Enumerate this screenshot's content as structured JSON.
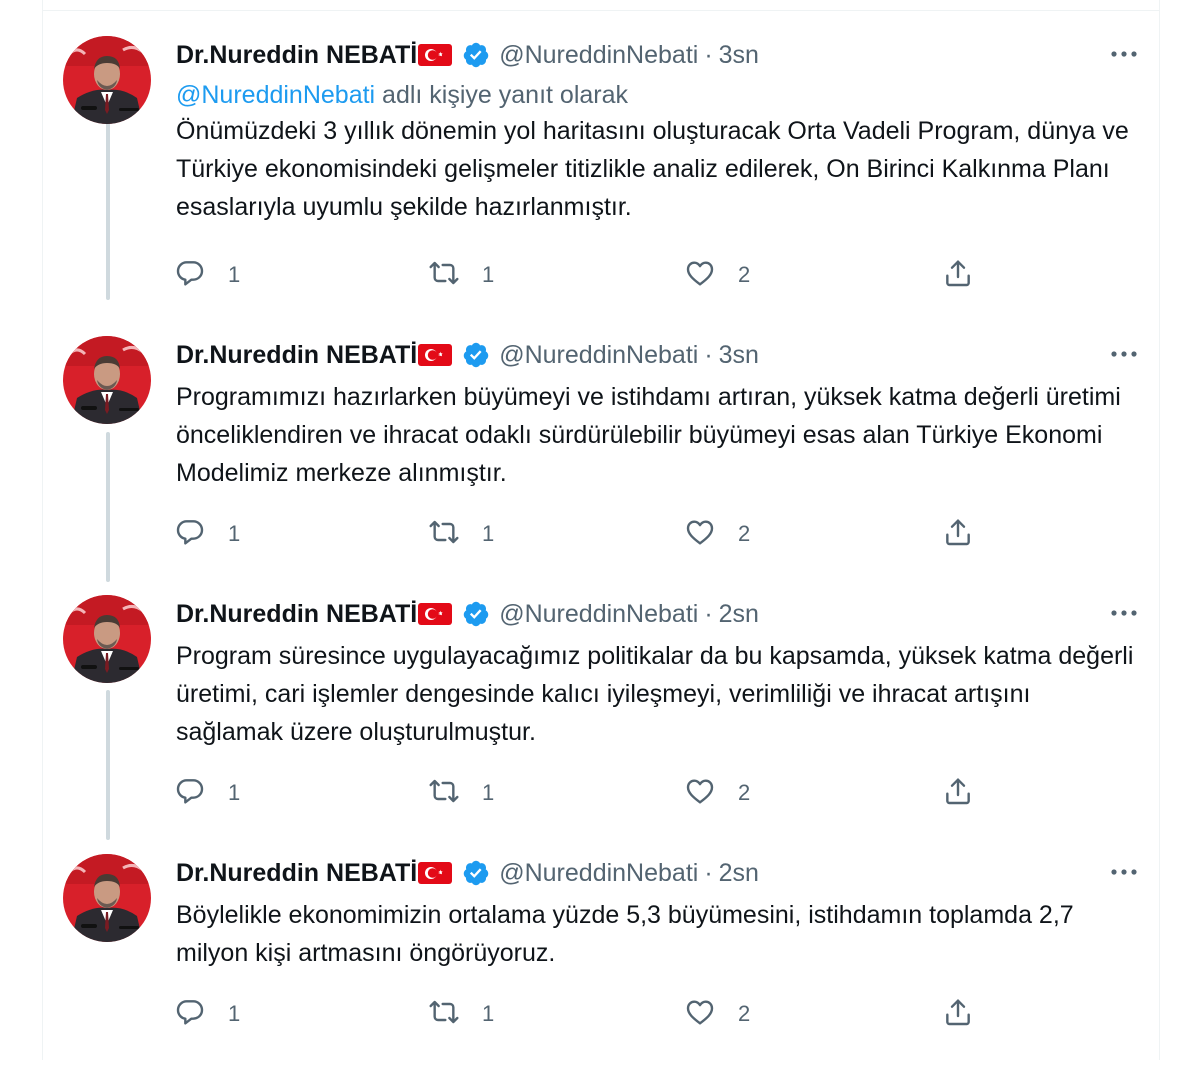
{
  "tweets": [
    {
      "name": "Dr.Nureddin NEBATİ",
      "handle": "@NureddinNebati",
      "separator": "·",
      "time": "3sn",
      "reply_to": {
        "mention": "@NureddinNebati",
        "suffix": " adlı kişiye yanıt olarak"
      },
      "text": "Önümüzdeki 3 yıllık dönemin yol haritasını oluşturacak Orta Vadeli Program, dünya ve Türkiye ekonomisindeki gelişmeler titizlikle analiz edilerek, On Birinci Kalkınma Planı esaslarıyla uyumlu şekilde hazırlanmıştır.",
      "replies": "1",
      "retweets": "1",
      "likes": "2"
    },
    {
      "name": "Dr.Nureddin NEBATİ",
      "handle": "@NureddinNebati",
      "separator": "·",
      "time": "3sn",
      "text": "Programımızı hazırlarken büyümeyi ve istihdamı artıran, yüksek katma değerli üretimi önceliklendiren ve ihracat odaklı sürdürülebilir büyümeyi esas alan Türkiye Ekonomi Modelimiz merkeze alınmıştır.",
      "replies": "1",
      "retweets": "1",
      "likes": "2"
    },
    {
      "name": "Dr.Nureddin NEBATİ",
      "handle": "@NureddinNebati",
      "separator": "·",
      "time": "2sn",
      "text": "Program süresince uygulayacağımız politikalar da bu kapsamda, yüksek katma değerli üretimi, cari işlemler dengesinde kalıcı iyileşmeyi, verimliliği ve ihracat artışını sağlamak üzere oluşturulmuştur.",
      "replies": "1",
      "retweets": "1",
      "likes": "2"
    },
    {
      "name": "Dr.Nureddin NEBATİ",
      "handle": "@NureddinNebati",
      "separator": "·",
      "time": "2sn",
      "text": "Böylelikle ekonomimizin ortalama yüzde 5,3 büyümesini, istihdamın toplamda 2,7 milyon kişi artmasını öngörüyoruz.",
      "replies": "1",
      "retweets": "1",
      "likes": "2"
    }
  ],
  "colors": {
    "text": "#0f1419",
    "secondary": "#536471",
    "accent": "#1d9bf0",
    "thread_line": "#cfd9de",
    "flag_red": "#e30a17"
  },
  "icons": {
    "reply": "reply-icon",
    "retweet": "retweet-icon",
    "like": "heart-icon",
    "share": "share-icon",
    "more": "more-icon",
    "verified": "verified-badge-icon",
    "flag": "turkey-flag-icon"
  }
}
